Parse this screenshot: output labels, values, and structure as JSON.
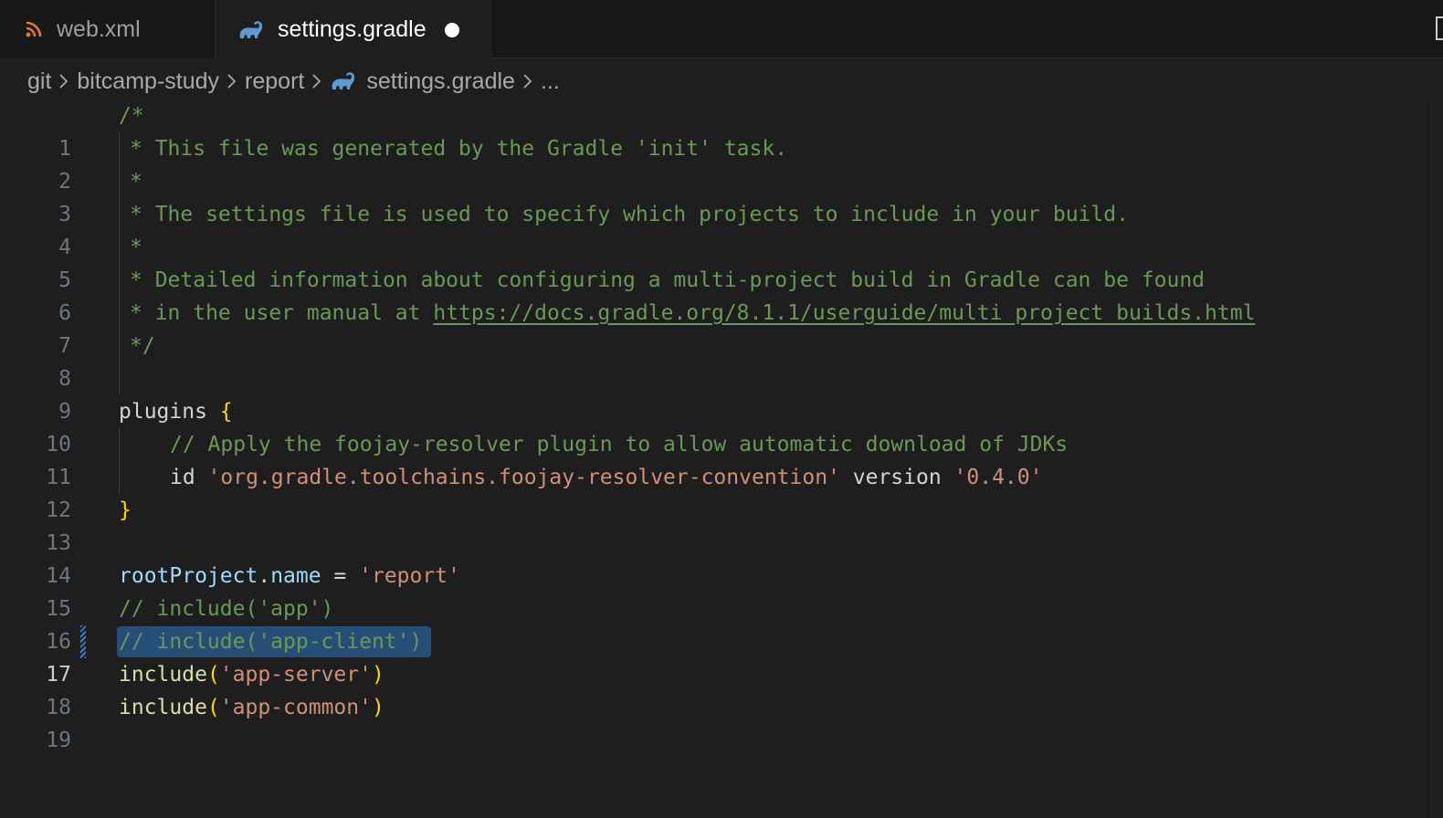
{
  "tabs": [
    {
      "label": "web.xml",
      "icon": "rss-icon",
      "active": false,
      "color": "#e37933"
    },
    {
      "label": "settings.gradle",
      "icon": "gradle-icon",
      "active": true,
      "dirty": true,
      "color": "#5a9bd5"
    }
  ],
  "breadcrumb": {
    "items": [
      "git",
      "bitcamp-study",
      "report",
      "settings.gradle",
      "..."
    ]
  },
  "editor": {
    "active_line": 17,
    "line_numbers": [
      "1",
      "2",
      "3",
      "4",
      "5",
      "6",
      "7",
      "8",
      "9",
      "10",
      "11",
      "12",
      "13",
      "14",
      "15",
      "16",
      "17",
      "18",
      "19"
    ],
    "lines": {
      "l1": "/*",
      "l2": "* This file was generated by the Gradle 'init' task.",
      "l3": "*",
      "l4": "* The settings file is used to specify which projects to include in your build.",
      "l5": "*",
      "l6": "* Detailed information about configuring a multi-project build in Gradle can be found",
      "l7a": "* in the user manual at ",
      "l7b": "https://docs.gradle.org/8.1.1/userguide/multi_project_builds.html",
      "l8": "*/",
      "l10a": "plugins ",
      "l10b": "{",
      "l11": "// Apply the foojay-resolver plugin to allow automatic download of JDKs",
      "l12a": "id ",
      "l12b": "'org.gradle.toolchains.foojay-resolver-convention'",
      "l12c": " version ",
      "l12d": "'0.4.0'",
      "l13": "}",
      "l15a": "rootProject",
      "l15b": ".",
      "l15c": "name",
      "l15d": " = ",
      "l15e": "'report'",
      "l16": "// include('app')",
      "l17": "// include('app-client')",
      "l18a": "include",
      "l18b": "(",
      "l18c": "'app-server'",
      "l18d": ")",
      "l19a": "include",
      "l19b": "(",
      "l19c": "'app-common'",
      "l19d": ")"
    }
  },
  "colors": {
    "comment": "#6a9955",
    "string": "#ce9178",
    "function": "#dcdcaa",
    "variable": "#9cdcfe",
    "bracket": "#ffd700",
    "selection": "#264f78"
  }
}
